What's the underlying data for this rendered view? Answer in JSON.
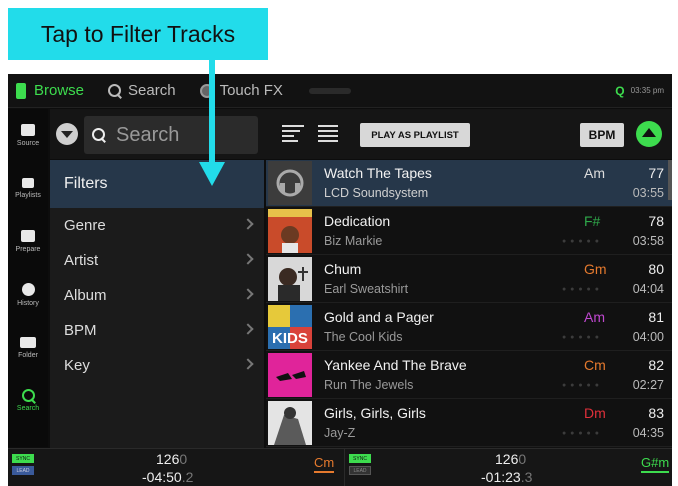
{
  "callout": {
    "text": "Tap to Filter Tracks"
  },
  "topbar": {
    "browse_label": "Browse",
    "search_label": "Search",
    "touchfx_label": "Touch FX",
    "status_icon": "Q",
    "clock": "03:35 pm"
  },
  "sidebar": {
    "items": [
      {
        "label": "Source",
        "icon": "source-icon"
      },
      {
        "label": "Playlists",
        "icon": "playlists-icon"
      },
      {
        "label": "Prepare",
        "icon": "prepare-icon"
      },
      {
        "label": "History",
        "icon": "history-icon"
      },
      {
        "label": "Folder",
        "icon": "folder-icon"
      },
      {
        "label": "Search",
        "icon": "search-icon",
        "active": true
      }
    ]
  },
  "controls": {
    "search_placeholder": "Search",
    "play_as_playlist": "PLAY AS PLAYLIST",
    "sort_column": "BPM"
  },
  "filters": {
    "header": "Filters",
    "items": [
      "Genre",
      "Artist",
      "Album",
      "BPM",
      "Key"
    ]
  },
  "tracks": [
    {
      "title": "Watch The Tapes",
      "artist": "LCD Soundsystem",
      "key": "Am",
      "key_color": "#dddddd",
      "bpm": "77",
      "time": "03:55",
      "selected": true
    },
    {
      "title": "Dedication",
      "artist": "Biz Markie",
      "key": "F#",
      "key_color": "#2fa84a",
      "bpm": "78",
      "time": "03:58"
    },
    {
      "title": "Chum",
      "artist": "Earl Sweatshirt",
      "key": "Gm",
      "key_color": "#e67a2e",
      "bpm": "80",
      "time": "04:04"
    },
    {
      "title": "Gold and a Pager",
      "artist": "The Cool Kids",
      "key": "Am",
      "key_color": "#c048d0",
      "bpm": "81",
      "time": "04:00"
    },
    {
      "title": "Yankee And The Brave",
      "artist": "Run The Jewels",
      "key": "Cm",
      "key_color": "#e67a2e",
      "bpm": "82",
      "time": "02:27"
    },
    {
      "title": "Girls, Girls, Girls",
      "artist": "Jay-Z",
      "key": "Dm",
      "key_color": "#e0303a",
      "bpm": "83",
      "time": "04:35"
    }
  ],
  "decks": [
    {
      "sync": "SYNC",
      "lead": "LEAD",
      "bpm": "126",
      "bpm_dim": "0",
      "time": "-04:50",
      "time_dim": ".2",
      "key": "Cm",
      "key_color": "#e67a2e"
    },
    {
      "sync": "SYNC",
      "lead": "LEAD",
      "bpm": "126",
      "bpm_dim": "0",
      "time": "-01:23",
      "time_dim": ".3",
      "key": "G#m",
      "key_color": "#3ddc4e"
    }
  ]
}
